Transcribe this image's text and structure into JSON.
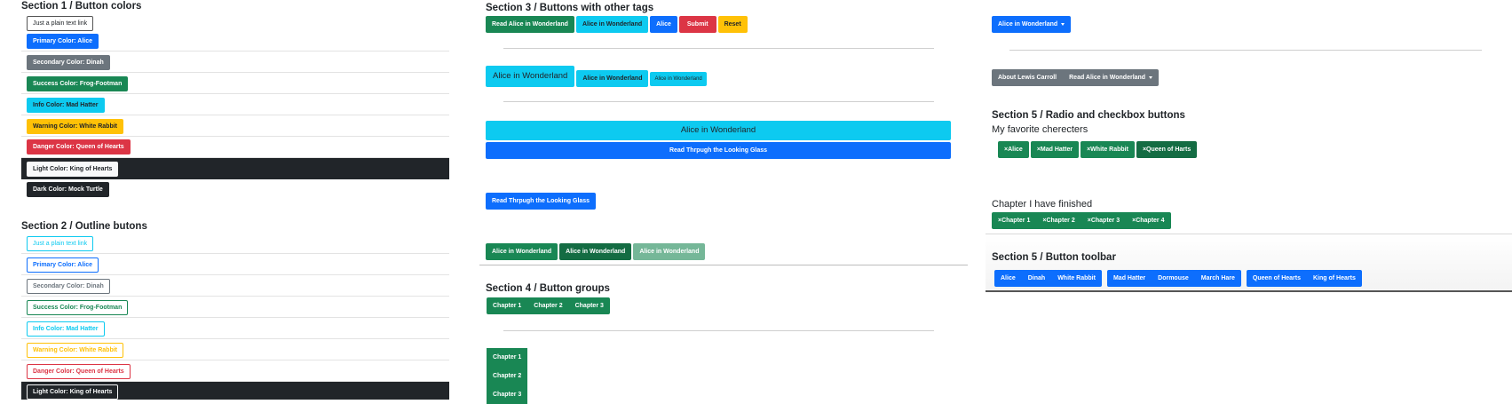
{
  "section1": {
    "title": "Section 1 / Button colors",
    "buttons": [
      "Just a plain text link",
      "Primary Color: Alice",
      "Secondary Color: Dinah",
      "Success Color: Frog-Footman",
      "Info Color: Mad Hatter",
      "Warning Color: White Rabbit",
      "Danger Color: Queen of Hearts",
      "Light Color: King of Hearts",
      "Dark Color: Mock Turtle"
    ]
  },
  "section2": {
    "title": "Section 2 / Outline butons",
    "buttons": [
      "Just a plain text link",
      "Primary Color: Alice",
      "Secondary Color: Dinah",
      "Success Color: Frog-Footman",
      "Info Color: Mad Hatter",
      "Warning Color: White Rabbit",
      "Danger Color: Queen of Hearts",
      "Light Color: King of Hearts"
    ]
  },
  "section3": {
    "title": "Section 3 / Buttons with other tags",
    "tag_buttons": [
      "Read Alice in Wonderland",
      "Alice in Wonderland",
      "Alice",
      "Submit",
      "Reset"
    ],
    "size_buttons": [
      "Alice in Wonderland",
      "Alice in Wonderland",
      "Alice in Wonderland"
    ],
    "block_buttons": [
      "Alice in Wonderland",
      "Read Thrpugh the Looking Glass"
    ],
    "single_button": "Read Thrpugh the Looking Glass",
    "state_buttons": [
      "Alice in Wonderland",
      "Alice in Wonderland",
      "Alice in Wonderland"
    ]
  },
  "section4": {
    "title": "Section 4 / Button groups",
    "horizontal": [
      "Chapter 1",
      "Chapter 2",
      "Chapter 3"
    ],
    "vertical": [
      "Chapter 1",
      "Chapter 2",
      "Chapter 3"
    ]
  },
  "col3": {
    "dropdown_label": "Alice in Wonderland",
    "nested_group": [
      "About Lewis Carroll",
      "Read Alice in Wonderland"
    ]
  },
  "section5a": {
    "title": "Section 5 / Radio and checkbox buttons",
    "subtitle": "My favorite cherecters",
    "characters": [
      "×Alice",
      "×Mad Hatter",
      "×White Rabbit",
      "×Queen of Harts"
    ],
    "chapters_title": "Chapter I have finished",
    "chapters": [
      "×Chapter 1",
      "×Chapter 2",
      "×Chapter 3",
      "×Chapter 4"
    ]
  },
  "section5b": {
    "title": "Section 5 / Button toolbar",
    "group1": [
      "Alice",
      "Dinah",
      "White Rabbit"
    ],
    "group2": [
      "Mad Hatter",
      "Dormouse",
      "March Hare"
    ],
    "group3": [
      "Queen of Hearts",
      "King of Hearts"
    ]
  }
}
